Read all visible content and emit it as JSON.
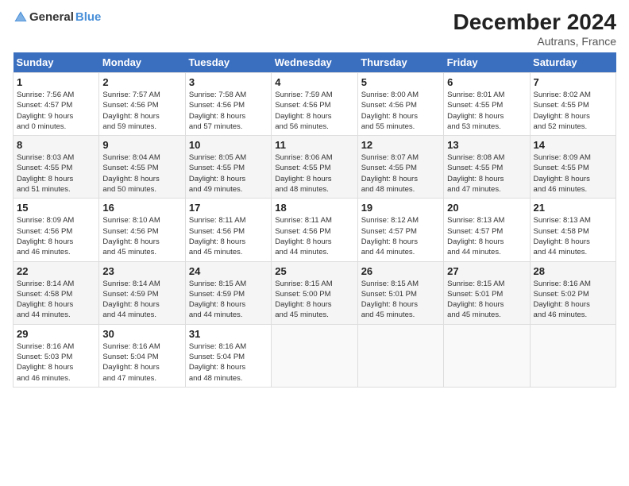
{
  "logo": {
    "text_general": "General",
    "text_blue": "Blue"
  },
  "title": "December 2024",
  "subtitle": "Autrans, France",
  "days_of_week": [
    "Sunday",
    "Monday",
    "Tuesday",
    "Wednesday",
    "Thursday",
    "Friday",
    "Saturday"
  ],
  "weeks": [
    [
      {
        "day": "1",
        "info": "Sunrise: 7:56 AM\nSunset: 4:57 PM\nDaylight: 9 hours\nand 0 minutes."
      },
      {
        "day": "2",
        "info": "Sunrise: 7:57 AM\nSunset: 4:56 PM\nDaylight: 8 hours\nand 59 minutes."
      },
      {
        "day": "3",
        "info": "Sunrise: 7:58 AM\nSunset: 4:56 PM\nDaylight: 8 hours\nand 57 minutes."
      },
      {
        "day": "4",
        "info": "Sunrise: 7:59 AM\nSunset: 4:56 PM\nDaylight: 8 hours\nand 56 minutes."
      },
      {
        "day": "5",
        "info": "Sunrise: 8:00 AM\nSunset: 4:56 PM\nDaylight: 8 hours\nand 55 minutes."
      },
      {
        "day": "6",
        "info": "Sunrise: 8:01 AM\nSunset: 4:55 PM\nDaylight: 8 hours\nand 53 minutes."
      },
      {
        "day": "7",
        "info": "Sunrise: 8:02 AM\nSunset: 4:55 PM\nDaylight: 8 hours\nand 52 minutes."
      }
    ],
    [
      {
        "day": "8",
        "info": "Sunrise: 8:03 AM\nSunset: 4:55 PM\nDaylight: 8 hours\nand 51 minutes."
      },
      {
        "day": "9",
        "info": "Sunrise: 8:04 AM\nSunset: 4:55 PM\nDaylight: 8 hours\nand 50 minutes."
      },
      {
        "day": "10",
        "info": "Sunrise: 8:05 AM\nSunset: 4:55 PM\nDaylight: 8 hours\nand 49 minutes."
      },
      {
        "day": "11",
        "info": "Sunrise: 8:06 AM\nSunset: 4:55 PM\nDaylight: 8 hours\nand 48 minutes."
      },
      {
        "day": "12",
        "info": "Sunrise: 8:07 AM\nSunset: 4:55 PM\nDaylight: 8 hours\nand 48 minutes."
      },
      {
        "day": "13",
        "info": "Sunrise: 8:08 AM\nSunset: 4:55 PM\nDaylight: 8 hours\nand 47 minutes."
      },
      {
        "day": "14",
        "info": "Sunrise: 8:09 AM\nSunset: 4:55 PM\nDaylight: 8 hours\nand 46 minutes."
      }
    ],
    [
      {
        "day": "15",
        "info": "Sunrise: 8:09 AM\nSunset: 4:56 PM\nDaylight: 8 hours\nand 46 minutes."
      },
      {
        "day": "16",
        "info": "Sunrise: 8:10 AM\nSunset: 4:56 PM\nDaylight: 8 hours\nand 45 minutes."
      },
      {
        "day": "17",
        "info": "Sunrise: 8:11 AM\nSunset: 4:56 PM\nDaylight: 8 hours\nand 45 minutes."
      },
      {
        "day": "18",
        "info": "Sunrise: 8:11 AM\nSunset: 4:56 PM\nDaylight: 8 hours\nand 44 minutes."
      },
      {
        "day": "19",
        "info": "Sunrise: 8:12 AM\nSunset: 4:57 PM\nDaylight: 8 hours\nand 44 minutes."
      },
      {
        "day": "20",
        "info": "Sunrise: 8:13 AM\nSunset: 4:57 PM\nDaylight: 8 hours\nand 44 minutes."
      },
      {
        "day": "21",
        "info": "Sunrise: 8:13 AM\nSunset: 4:58 PM\nDaylight: 8 hours\nand 44 minutes."
      }
    ],
    [
      {
        "day": "22",
        "info": "Sunrise: 8:14 AM\nSunset: 4:58 PM\nDaylight: 8 hours\nand 44 minutes."
      },
      {
        "day": "23",
        "info": "Sunrise: 8:14 AM\nSunset: 4:59 PM\nDaylight: 8 hours\nand 44 minutes."
      },
      {
        "day": "24",
        "info": "Sunrise: 8:15 AM\nSunset: 4:59 PM\nDaylight: 8 hours\nand 44 minutes."
      },
      {
        "day": "25",
        "info": "Sunrise: 8:15 AM\nSunset: 5:00 PM\nDaylight: 8 hours\nand 45 minutes."
      },
      {
        "day": "26",
        "info": "Sunrise: 8:15 AM\nSunset: 5:01 PM\nDaylight: 8 hours\nand 45 minutes."
      },
      {
        "day": "27",
        "info": "Sunrise: 8:15 AM\nSunset: 5:01 PM\nDaylight: 8 hours\nand 45 minutes."
      },
      {
        "day": "28",
        "info": "Sunrise: 8:16 AM\nSunset: 5:02 PM\nDaylight: 8 hours\nand 46 minutes."
      }
    ],
    [
      {
        "day": "29",
        "info": "Sunrise: 8:16 AM\nSunset: 5:03 PM\nDaylight: 8 hours\nand 46 minutes."
      },
      {
        "day": "30",
        "info": "Sunrise: 8:16 AM\nSunset: 5:04 PM\nDaylight: 8 hours\nand 47 minutes."
      },
      {
        "day": "31",
        "info": "Sunrise: 8:16 AM\nSunset: 5:04 PM\nDaylight: 8 hours\nand 48 minutes."
      },
      {
        "day": "",
        "info": ""
      },
      {
        "day": "",
        "info": ""
      },
      {
        "day": "",
        "info": ""
      },
      {
        "day": "",
        "info": ""
      }
    ]
  ]
}
